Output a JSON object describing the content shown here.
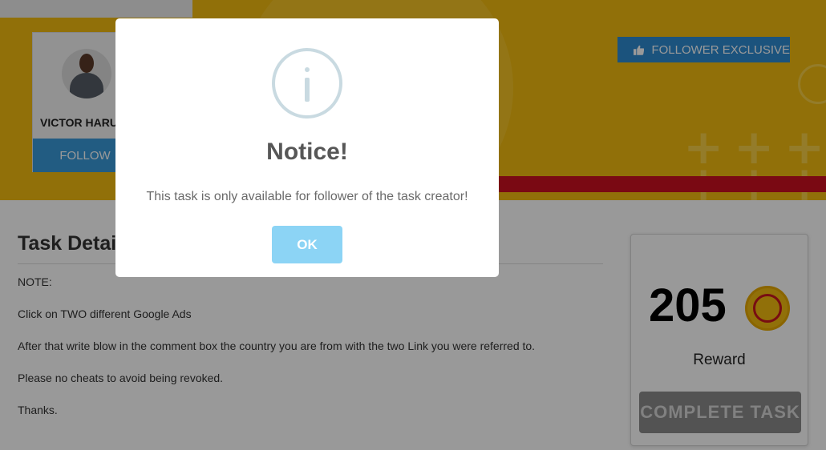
{
  "profile": {
    "name": "VICTOR HARU",
    "follow_label": "FOLLOW"
  },
  "banner": {
    "badge_label": "FOLLOWER EXCLUSIVE",
    "badge_icon": "thumbs-up-icon",
    "brand_color": "#f2bb10",
    "badge_color": "#2d8ad0"
  },
  "task": {
    "title": "Task Detail",
    "lines": [
      "NOTE:",
      "Click on TWO different Google Ads",
      "After that write blow in the comment box the country you are from with the two Link you were referred to.",
      "Please no cheats to avoid being revoked.",
      "Thanks."
    ]
  },
  "reward": {
    "value": "205",
    "label": "Reward",
    "button_label": "COMPLETE TASK"
  },
  "modal": {
    "icon": "info-icon",
    "title": "Notice!",
    "message": "This task is only available for follower of the task creator!",
    "ok_label": "OK",
    "ok_color": "#8cd4f5"
  }
}
